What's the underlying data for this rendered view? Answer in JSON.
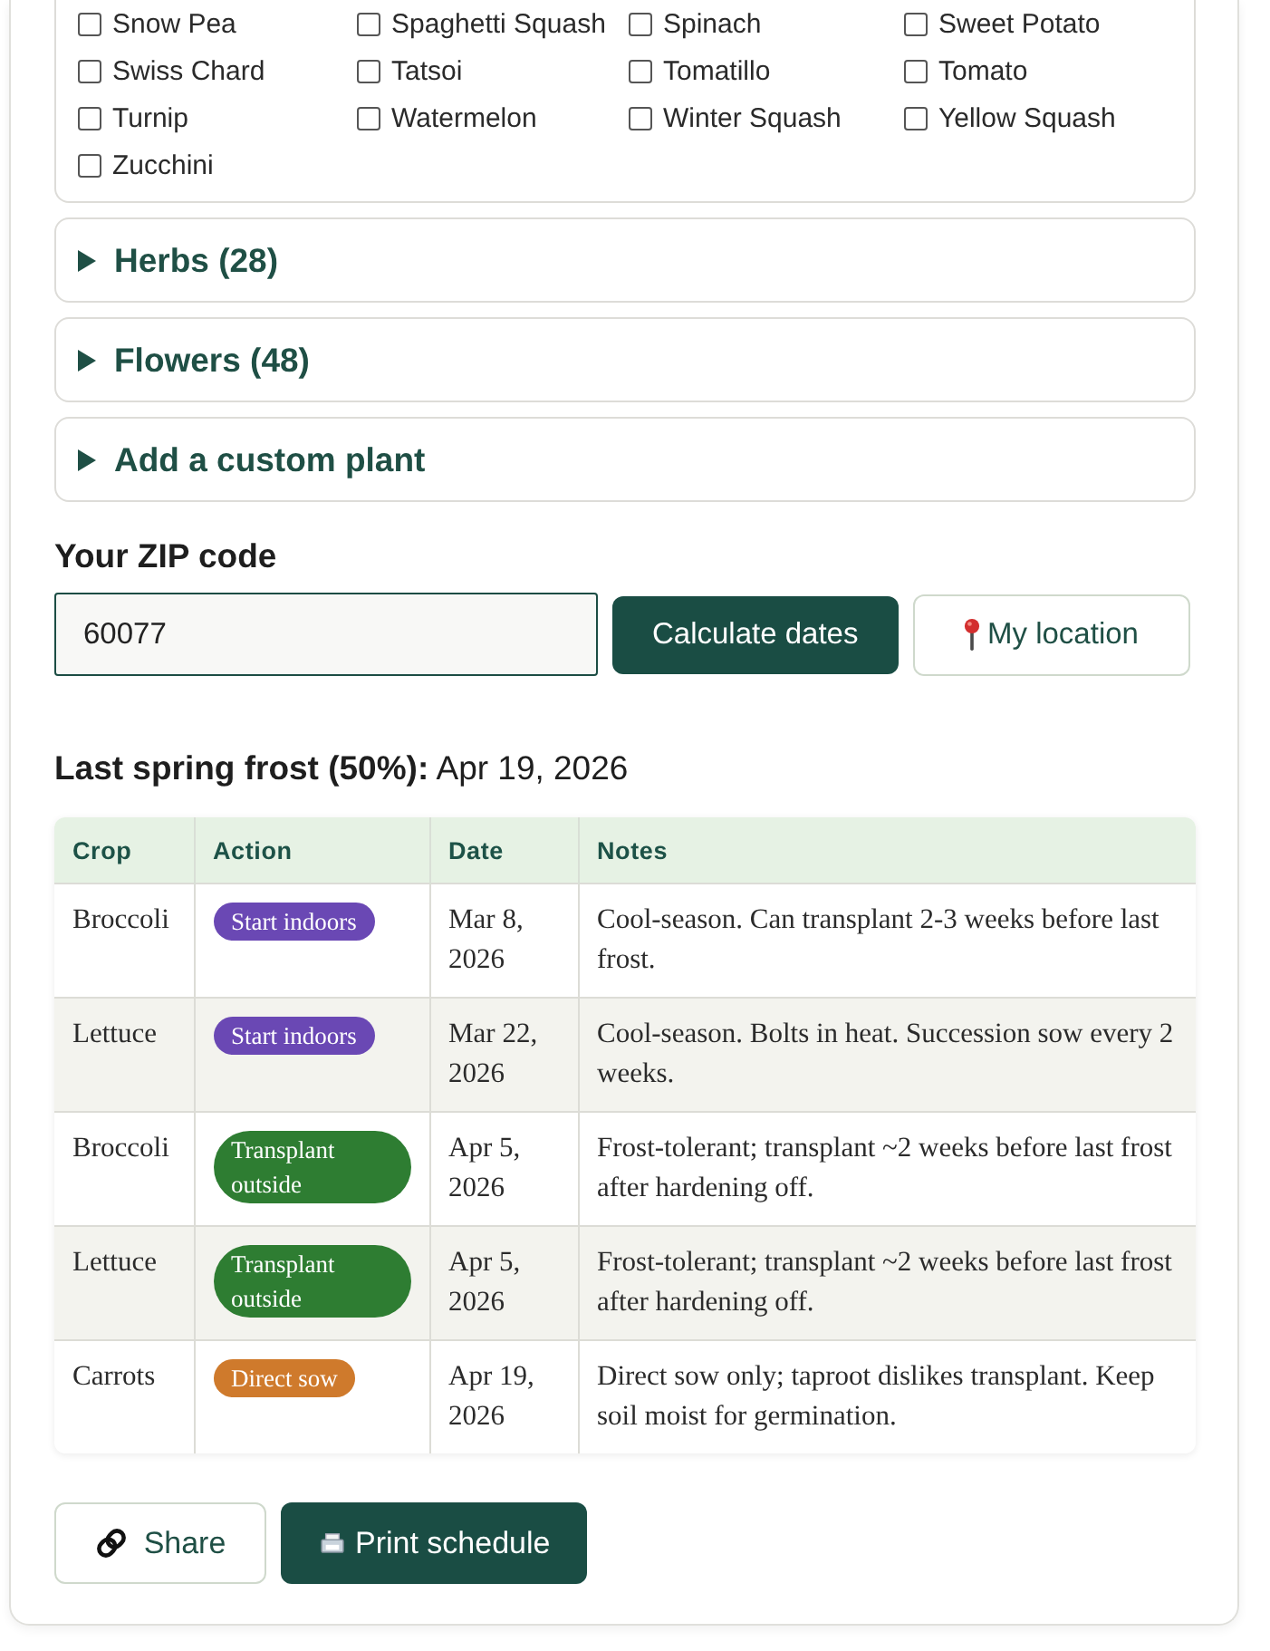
{
  "plant_list": {
    "items": [
      {
        "label": "Snow Pea",
        "checked": false
      },
      {
        "label": "Spaghetti Squash",
        "checked": false
      },
      {
        "label": "Spinach",
        "checked": false
      },
      {
        "label": "Sweet Potato",
        "checked": false
      },
      {
        "label": "Swiss Chard",
        "checked": false
      },
      {
        "label": "Tatsoi",
        "checked": false
      },
      {
        "label": "Tomatillo",
        "checked": false
      },
      {
        "label": "Tomato",
        "checked": false
      },
      {
        "label": "Turnip",
        "checked": false
      },
      {
        "label": "Watermelon",
        "checked": false
      },
      {
        "label": "Winter Squash",
        "checked": false
      },
      {
        "label": "Yellow Squash",
        "checked": false
      },
      {
        "label": "Zucchini",
        "checked": false
      }
    ]
  },
  "sections": [
    {
      "title": "Herbs (28)",
      "expanded": false
    },
    {
      "title": "Flowers (48)",
      "expanded": false
    },
    {
      "title": "Add a custom plant",
      "expanded": false
    }
  ],
  "zip": {
    "label": "Your ZIP code",
    "value": "60077",
    "buttons": [
      {
        "label": "Calculate dates",
        "kind": "primary"
      },
      {
        "label": "My location",
        "kind": "location"
      }
    ]
  },
  "frost": {
    "text": "**Last spring frost (50%):** Apr 19, 2026"
  },
  "schedule": {
    "columns": [
      "Crop",
      "Action",
      "Date",
      "Notes"
    ],
    "rows": [
      {
        "crop": "Broccoli",
        "action": {
          "label": "Start indoors",
          "color": "#6a48b4"
        },
        "date": "Mar 8, 2026",
        "notes": "Cool-season. Can transplant 2-3 weeks before last frost."
      },
      {
        "crop": "Lettuce",
        "action": {
          "label": "Start indoors",
          "color": "#6a48b4"
        },
        "date": "Mar 22, 2026",
        "notes": "Cool-season. Bolts in heat. Succession sow every 2 weeks."
      },
      {
        "crop": "Broccoli",
        "action": {
          "label": "Transplant outside",
          "color": "#2e7d32"
        },
        "date": "Apr 5, 2026",
        "notes": "Frost-tolerant; transplant ~2 weeks before last frost after hardening off."
      },
      {
        "crop": "Lettuce",
        "action": {
          "label": "Transplant outside",
          "color": "#2e7d32"
        },
        "date": "Apr 5, 2026",
        "notes": "Frost-tolerant; transplant ~2 weeks before last frost after hardening off."
      },
      {
        "crop": "Carrots",
        "action": {
          "label": "Direct sow",
          "color": "#cf7a2c"
        },
        "date": "Apr 19, 2026",
        "notes": "Direct sow only; taproot dislikes transplant. Keep soil moist for germination."
      }
    ]
  },
  "actions": [
    {
      "label": "Share",
      "kind": "share"
    },
    {
      "label": "Print schedule",
      "kind": "print"
    }
  ]
}
